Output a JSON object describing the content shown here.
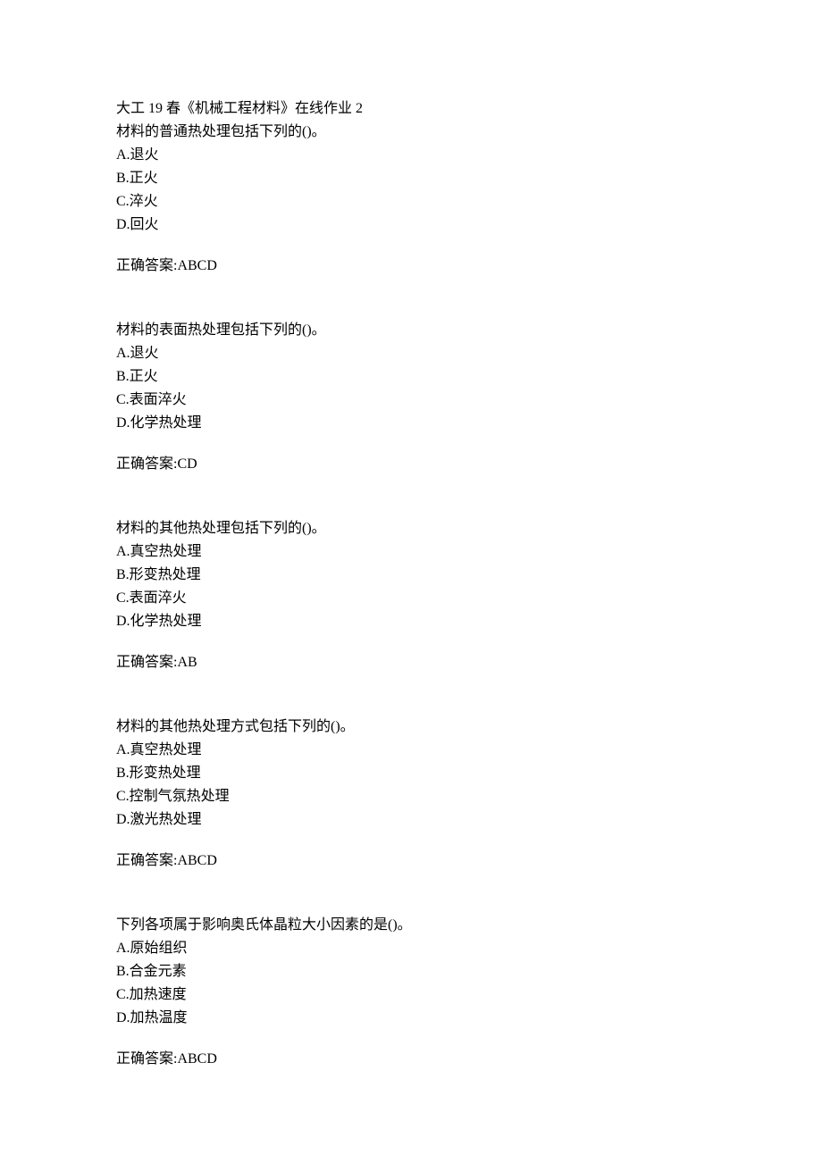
{
  "header": "大工 19 春《机械工程材料》在线作业 2",
  "answer_prefix": "正确答案:",
  "questions": [
    {
      "stem": "材料的普通热处理包括下列的()。",
      "options": [
        "A.退火",
        "B.正火",
        "C.淬火",
        "D.回火"
      ],
      "answer": "ABCD"
    },
    {
      "stem": "材料的表面热处理包括下列的()。",
      "options": [
        "A.退火",
        "B.正火",
        "C.表面淬火",
        "D.化学热处理"
      ],
      "answer": "CD"
    },
    {
      "stem": "材料的其他热处理包括下列的()。",
      "options": [
        "A.真空热处理",
        "B.形变热处理",
        "C.表面淬火",
        "D.化学热处理"
      ],
      "answer": "AB"
    },
    {
      "stem": "材料的其他热处理方式包括下列的()。",
      "options": [
        "A.真空热处理",
        "B.形变热处理",
        "C.控制气氛热处理",
        "D.激光热处理"
      ],
      "answer": "ABCD"
    },
    {
      "stem": "下列各项属于影响奥氏体晶粒大小因素的是()。",
      "options": [
        "A.原始组织",
        "B.合金元素",
        "C.加热速度",
        "D.加热温度"
      ],
      "answer": "ABCD"
    }
  ]
}
